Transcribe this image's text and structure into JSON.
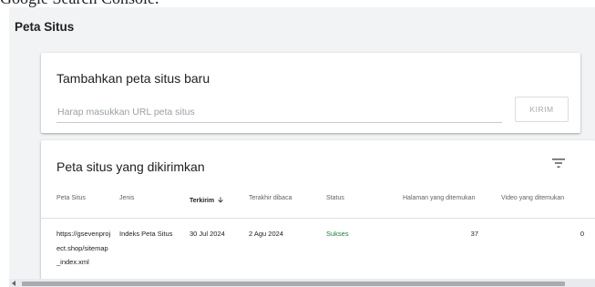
{
  "caption": "Google Search Console.",
  "page_title": "Peta Situs",
  "add_card": {
    "title": "Tambahkan peta situs baru",
    "input_placeholder": "Harap masukkan URL peta situs",
    "input_value": "",
    "submit_label": "KIRIM"
  },
  "list_card": {
    "title": "Peta situs yang dikirimkan",
    "filter_icon": "filter-icon",
    "columns": [
      "Peta Situs",
      "Jenis",
      "Terkirim",
      "Terakhir dibaca",
      "Status",
      "Halaman yang ditemukan",
      "Video yang ditemukan"
    ],
    "sorted_column_icon": "arrow-down-icon",
    "rows": [
      {
        "sitemap": "https://gsevenproject.shop/sitemap_index.xml",
        "type": "Indeks Peta Situs",
        "submitted": "30 Jul 2024",
        "last_read": "2 Agu 2024",
        "status": "Sukses",
        "pages": "37",
        "videos": "0"
      }
    ]
  },
  "colors": {
    "status_success": "#188038",
    "background": "#f1f3f4"
  }
}
